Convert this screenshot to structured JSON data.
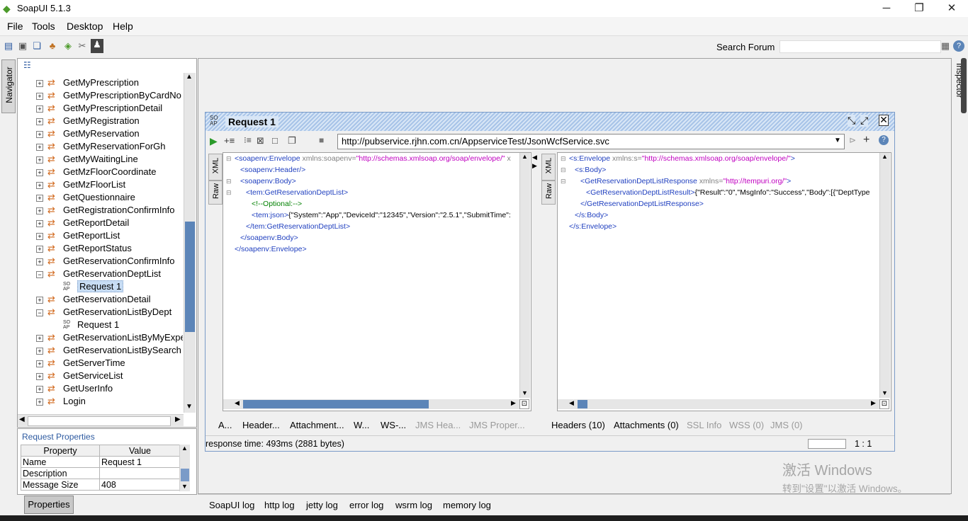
{
  "window": {
    "title": "SoapUI 5.1.3"
  },
  "menu": [
    "File",
    "Tools",
    "Desktop",
    "Help"
  ],
  "toolbar": {
    "search_label": "Search Forum",
    "search_value": ""
  },
  "navigator": {
    "tab_label": "Navigator"
  },
  "tree": {
    "items": [
      {
        "label": "GetMyPrescription",
        "expanded": false
      },
      {
        "label": "GetMyPrescriptionByCardNo",
        "expanded": false
      },
      {
        "label": "GetMyPrescriptionDetail",
        "expanded": false
      },
      {
        "label": "GetMyRegistration",
        "expanded": false
      },
      {
        "label": "GetMyReservation",
        "expanded": false
      },
      {
        "label": "GetMyReservationForGh",
        "expanded": false
      },
      {
        "label": "GetMyWaitingLine",
        "expanded": false
      },
      {
        "label": "GetMzFloorCoordinate",
        "expanded": false
      },
      {
        "label": "GetMzFloorList",
        "expanded": false
      },
      {
        "label": "GetQuestionnaire",
        "expanded": false
      },
      {
        "label": "GetRegistrationConfirmInfo",
        "expanded": false
      },
      {
        "label": "GetReportDetail",
        "expanded": false
      },
      {
        "label": "GetReportList",
        "expanded": false
      },
      {
        "label": "GetReportStatus",
        "expanded": false
      },
      {
        "label": "GetReservationConfirmInfo",
        "expanded": false
      },
      {
        "label": "GetReservationDeptList",
        "expanded": true
      },
      {
        "label": "Request 1",
        "child": true,
        "selected": true
      },
      {
        "label": "GetReservationDetail",
        "expanded": false
      },
      {
        "label": "GetReservationListByDept",
        "expanded": true
      },
      {
        "label": "Request 1",
        "child": true,
        "selected": false
      },
      {
        "label": "GetReservationListByMyExper",
        "expanded": false
      },
      {
        "label": "GetReservationListBySearch",
        "expanded": false
      },
      {
        "label": "GetServerTime",
        "expanded": false
      },
      {
        "label": "GetServiceList",
        "expanded": false
      },
      {
        "label": "GetUserInfo",
        "expanded": false
      },
      {
        "label": "Login",
        "expanded": false
      }
    ]
  },
  "request_properties": {
    "title": "Request Properties",
    "headers": [
      "Property",
      "Value"
    ],
    "rows": [
      [
        "Name",
        "Request 1"
      ],
      [
        "Description",
        ""
      ],
      [
        "Message Size",
        "408"
      ]
    ],
    "button_label": "Properties"
  },
  "inspector": {
    "label": "Inspector"
  },
  "request_window": {
    "title": "Request 1",
    "url": "http://pubservice.rjhn.com.cn/AppserviceTest/JsonWcfService.svc",
    "left_tabs": [
      "XML",
      "Raw"
    ],
    "right_tabs": [
      "XML",
      "Raw"
    ],
    "request_xml": [
      {
        "indent": 0,
        "parts": [
          [
            "tag",
            "<soapenv:Envelope "
          ],
          [
            "attr",
            "xmlns:soapenv="
          ],
          [
            "val",
            "\"http://schemas.xmlsoap.org/soap/envelope/\""
          ],
          [
            "attr",
            " x"
          ]
        ]
      },
      {
        "indent": 1,
        "parts": [
          [
            "tag",
            "<soapenv:Header/>"
          ]
        ]
      },
      {
        "indent": 1,
        "parts": [
          [
            "tag",
            "<soapenv:Body>"
          ]
        ]
      },
      {
        "indent": 2,
        "parts": [
          [
            "tag",
            "<tem:GetReservationDeptList>"
          ]
        ]
      },
      {
        "indent": 3,
        "parts": [
          [
            "cmt",
            "<!--Optional:-->"
          ]
        ]
      },
      {
        "indent": 3,
        "parts": [
          [
            "tag",
            "<tem:json>"
          ],
          [
            "txt",
            "{\"System\":\"App\",\"DeviceId\":\"12345\",\"Version\":\"2.5.1\",\"SubmitTime\":"
          ]
        ]
      },
      {
        "indent": 2,
        "parts": [
          [
            "tag",
            "</tem:GetReservationDeptList>"
          ]
        ]
      },
      {
        "indent": 1,
        "parts": [
          [
            "tag",
            "</soapenv:Body>"
          ]
        ]
      },
      {
        "indent": 0,
        "parts": [
          [
            "tag",
            "</soapenv:Envelope>"
          ]
        ]
      }
    ],
    "response_xml": [
      {
        "indent": 0,
        "parts": [
          [
            "tag",
            "<s:Envelope "
          ],
          [
            "attr",
            "xmlns:s="
          ],
          [
            "val",
            "\"http://schemas.xmlsoap.org/soap/envelope/\""
          ],
          [
            "tag",
            ">"
          ]
        ]
      },
      {
        "indent": 1,
        "parts": [
          [
            "tag",
            "<s:Body>"
          ]
        ]
      },
      {
        "indent": 2,
        "parts": [
          [
            "tag",
            "<GetReservationDeptListResponse "
          ],
          [
            "attr",
            "xmlns="
          ],
          [
            "val",
            "\"http://tempuri.org/\""
          ],
          [
            "tag",
            ">"
          ]
        ]
      },
      {
        "indent": 3,
        "parts": [
          [
            "tag",
            "<GetReservationDeptListResult>"
          ],
          [
            "txt",
            "{\"Result\":\"0\",\"MsgInfo\":\"Success\",\"Body\":[{\"DeptType"
          ]
        ]
      },
      {
        "indent": 2,
        "parts": [
          [
            "tag",
            "</GetReservationDeptListResponse>"
          ]
        ]
      },
      {
        "indent": 1,
        "parts": [
          [
            "tag",
            "</s:Body>"
          ]
        ]
      },
      {
        "indent": 0,
        "parts": [
          [
            "tag",
            "</s:Envelope>"
          ]
        ]
      }
    ],
    "request_subtabs": [
      {
        "label": "A...",
        "enabled": true
      },
      {
        "label": "Header...",
        "enabled": true
      },
      {
        "label": "Attachment...",
        "enabled": true
      },
      {
        "label": "W...",
        "enabled": true
      },
      {
        "label": "WS-...",
        "enabled": true
      },
      {
        "label": "JMS Hea...",
        "enabled": false
      },
      {
        "label": "JMS Proper...",
        "enabled": false
      }
    ],
    "response_subtabs": [
      {
        "label": "Headers (10)",
        "enabled": true
      },
      {
        "label": "Attachments (0)",
        "enabled": true
      },
      {
        "label": "SSL Info",
        "enabled": false
      },
      {
        "label": "WSS (0)",
        "enabled": false
      },
      {
        "label": "JMS (0)",
        "enabled": false
      }
    ],
    "status": "response time: 493ms (2881 bytes)",
    "position": "1 : 1"
  },
  "logs": [
    "SoapUI log",
    "http log",
    "jetty log",
    "error log",
    "wsrm log",
    "memory log"
  ],
  "watermark": {
    "line1": "激活 Windows",
    "line2": "转到\"设置\"以激活 Windows。"
  },
  "colors": {
    "tag": "#1f3fbf",
    "attr": "#808080",
    "value": "#c000c0",
    "comment": "#008000",
    "accent": "#5c85b8"
  }
}
